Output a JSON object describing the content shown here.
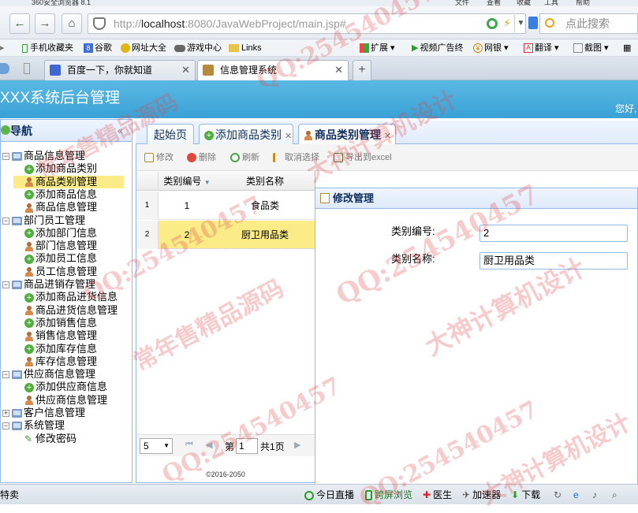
{
  "browser": {
    "title_partial": "360安全浏览器 8.1",
    "menu": [
      "文件",
      "查看",
      "收藏",
      "工具",
      "帮助"
    ],
    "address": {
      "prefix": "http://",
      "host": "localhost",
      "rest": ":8080/JavaWebProject/main.jsp#"
    },
    "search_placeholder": "点此搜索",
    "bookmarks": [
      "手机收藏夹",
      "谷歌",
      "网址大全",
      "游戏中心",
      "Links"
    ],
    "bookmarks_right": [
      "扩展",
      "视频广告终",
      "网银",
      "翻译",
      "截图"
    ],
    "tabs": [
      {
        "label": "百度一下，你就知道",
        "active": false
      },
      {
        "label": "信息管理系统",
        "active": true
      }
    ],
    "new_tab": "+",
    "statusbar_left": "特卖",
    "statusbar_items": [
      "今日直播",
      "跨屏浏览",
      "医生",
      "加速器",
      "下载"
    ]
  },
  "app": {
    "title": "XXX系统后台管理",
    "user_link": "您好,",
    "nav_title": "导航",
    "tree": [
      {
        "type": "group",
        "label": "商品信息管理"
      },
      {
        "type": "add",
        "label": "添加商品类别"
      },
      {
        "type": "user",
        "label": "商品类别管理",
        "selected": true
      },
      {
        "type": "add",
        "label": "添加商品信息"
      },
      {
        "type": "user",
        "label": "商品信息管理"
      },
      {
        "type": "group",
        "label": "部门员工管理"
      },
      {
        "type": "add",
        "label": "添加部门信息"
      },
      {
        "type": "user",
        "label": "部门信息管理"
      },
      {
        "type": "add",
        "label": "添加员工信息"
      },
      {
        "type": "user",
        "label": "员工信息管理"
      },
      {
        "type": "group",
        "label": "商品进销存管理"
      },
      {
        "type": "add",
        "label": "添加商品进货信息"
      },
      {
        "type": "user",
        "label": "商品进货信息管理"
      },
      {
        "type": "add",
        "label": "添加销售信息"
      },
      {
        "type": "user",
        "label": "销售信息管理"
      },
      {
        "type": "add",
        "label": "添加库存信息"
      },
      {
        "type": "user",
        "label": "库存信息管理"
      },
      {
        "type": "group",
        "label": "供应商信息管理"
      },
      {
        "type": "add",
        "label": "添加供应商信息"
      },
      {
        "type": "user",
        "label": "供应商信息管理"
      },
      {
        "type": "group-collapsed",
        "label": "客户信息管理"
      },
      {
        "type": "group",
        "label": "系统管理"
      },
      {
        "type": "pencil",
        "label": "修改密码"
      }
    ],
    "tabs": [
      {
        "label": "起始页"
      },
      {
        "label": "添加商品类别"
      },
      {
        "label": "商品类别管理",
        "active": true
      }
    ],
    "toolbar": [
      "修改",
      "删除",
      "刷新",
      "取消选择",
      "导出到excel"
    ],
    "grid": {
      "headers": [
        "类别编号",
        "类别名称"
      ],
      "rows": [
        {
          "num": "1",
          "id": "1",
          "name": "食品类",
          "selected": false
        },
        {
          "num": "2",
          "id": "2",
          "name": "厨卫用品类",
          "selected": true
        }
      ]
    },
    "pager": {
      "page_size": "5",
      "page_label": "第",
      "page_value": "1",
      "total": "共1页"
    },
    "footer": "©2016-2050",
    "dialog": {
      "title": "修改管理",
      "fields": [
        {
          "label": "类别编号:",
          "value": "2"
        },
        {
          "label": "类别名称:",
          "value": "厨卫用品类"
        }
      ]
    }
  },
  "watermarks": [
    "QQ:254540457",
    "常年售精品源码",
    "大神计算机设计"
  ],
  "colors": {
    "header": "#3fa6d9",
    "panel_border": "#95b8e7",
    "selected_row": "#fbec88"
  }
}
